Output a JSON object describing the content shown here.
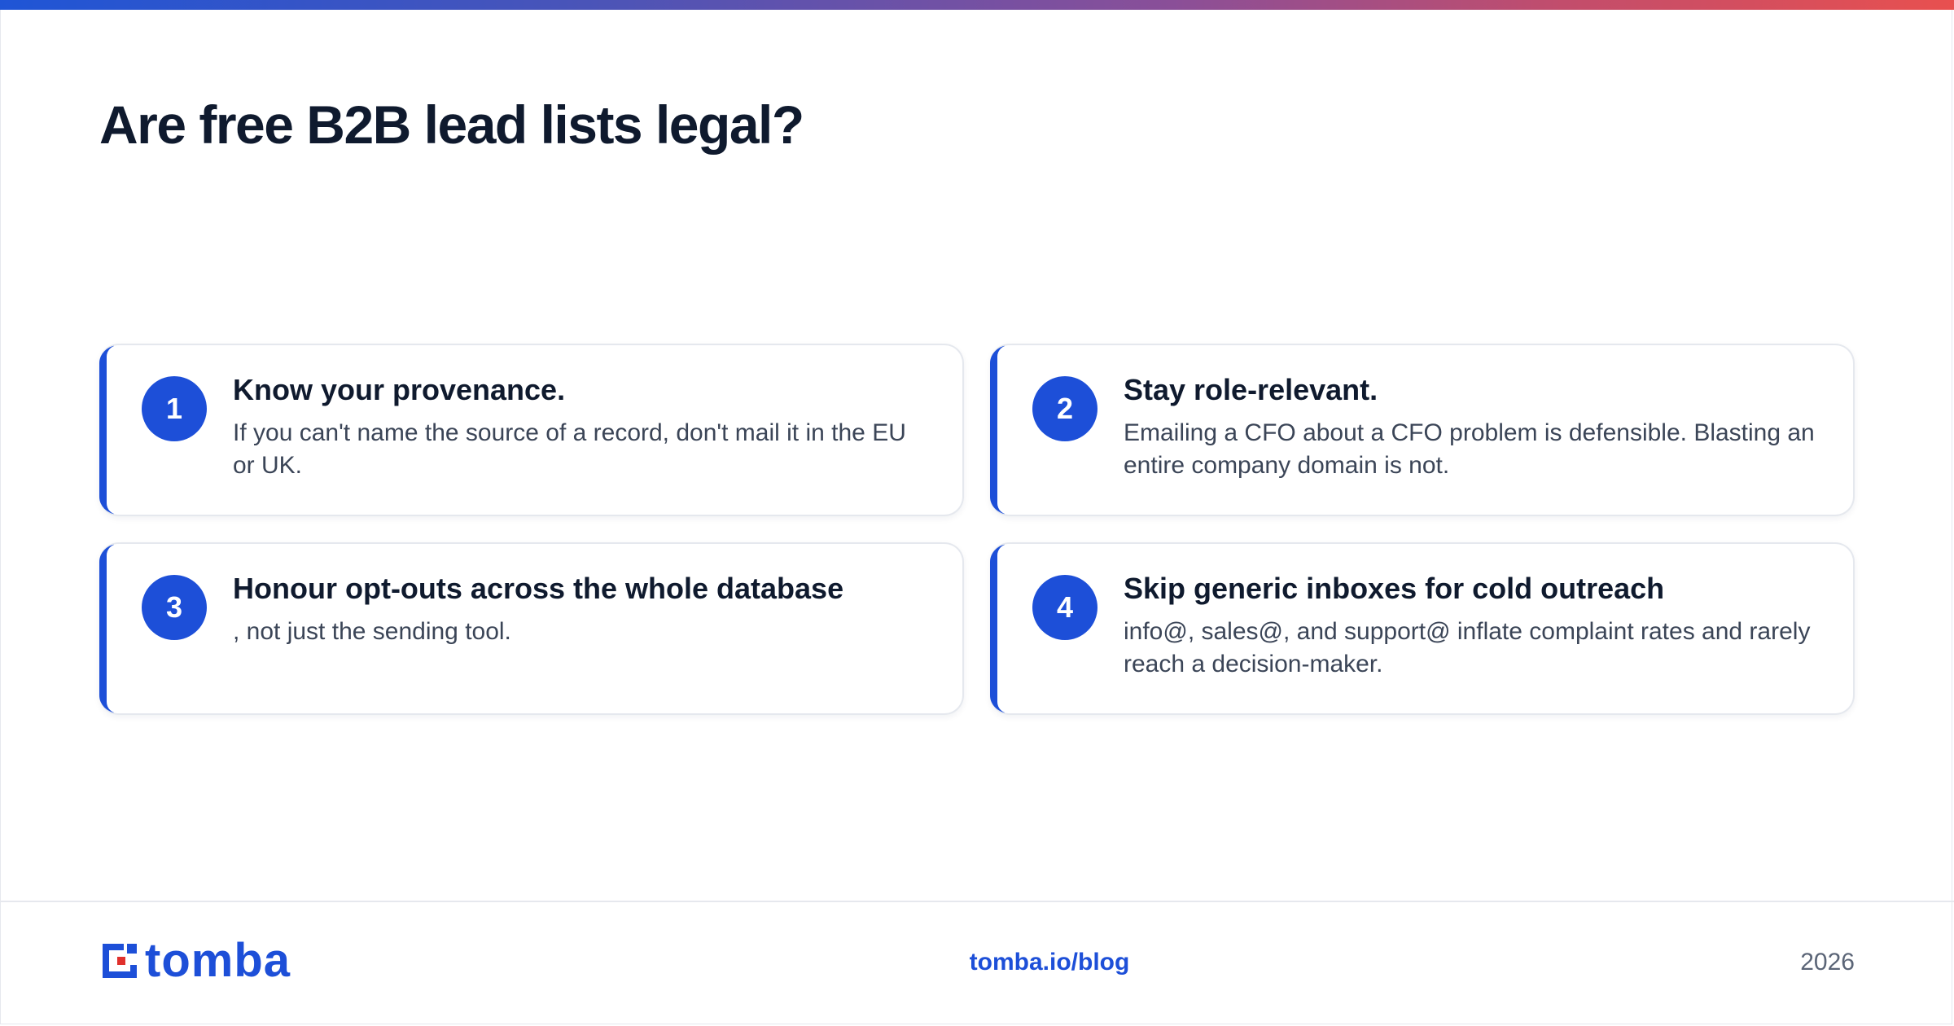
{
  "slide": {
    "title": "Are free B2B lead lists legal?"
  },
  "cards": [
    {
      "number": "1",
      "heading": "Know your provenance.",
      "description": "If you can't name the source of a record, don't mail it in the EU or UK."
    },
    {
      "number": "2",
      "heading": "Stay role-relevant.",
      "description": "Emailing a CFO about a CFO problem is defensible. Blasting an entire company domain is not."
    },
    {
      "number": "3",
      "heading": "Honour opt-outs across the whole database",
      "description": ", not just the sending tool."
    },
    {
      "number": "4",
      "heading": "Skip generic inboxes for cold outreach",
      "description": "info@, sales@, and support@ inflate complaint rates and rarely reach a decision-maker."
    }
  ],
  "footer": {
    "logo_text": "tomba",
    "link": "tomba.io/blog",
    "year": "2026"
  },
  "colors": {
    "accent": "#1d4fd8",
    "logo_secondary": "#e0302c",
    "title": "#0f1a2e",
    "body_text": "#3b4557"
  },
  "icons": {
    "logo_mark": "tomba-logo-icon"
  }
}
